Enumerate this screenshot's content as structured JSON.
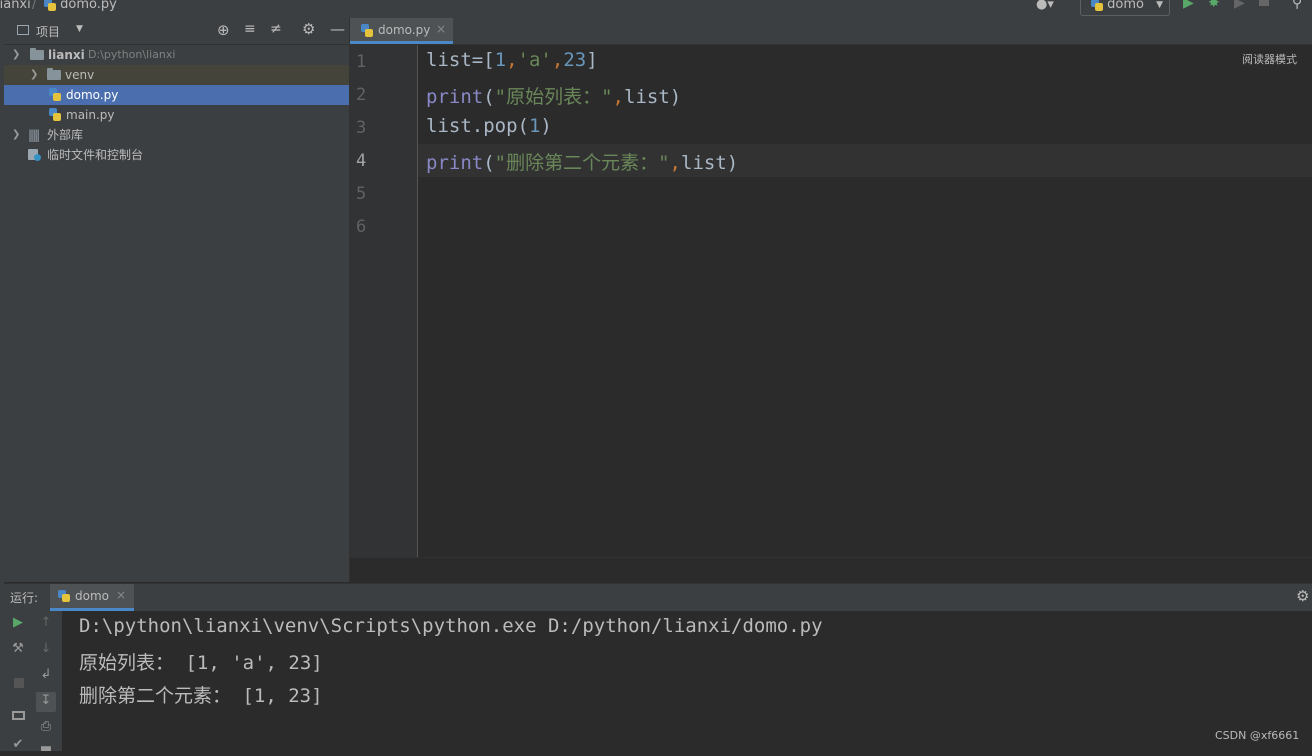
{
  "breadcrumb": {
    "project": "lianxi",
    "file": "domo.py"
  },
  "toolbar": {
    "run_config": "domo"
  },
  "project_panel": {
    "title": "项目",
    "tree": [
      {
        "label": "lianxi",
        "path": "D:\\python\\lianxi"
      },
      {
        "label": "venv"
      },
      {
        "label": "domo.py"
      },
      {
        "label": "main.py"
      },
      {
        "label": "外部库"
      },
      {
        "label": "临时文件和控制台"
      }
    ]
  },
  "editor": {
    "tab": "domo.py",
    "reader_mode": "阅读器模式",
    "line_numbers": [
      "1",
      "2",
      "3",
      "4",
      "5",
      "6"
    ],
    "lines": [
      {
        "p": [
          "list=[",
          "1",
          ",",
          "'a'",
          ",",
          "23",
          "]"
        ]
      },
      {
        "p": [
          "print",
          "(",
          "\"原始列表：\"",
          ",",
          "list)"
        ]
      },
      {
        "p": [
          "list.pop(",
          "1",
          ")"
        ]
      },
      {
        "p": [
          "print",
          "(",
          "\"删除第二个元素：\"",
          ",",
          "list)"
        ]
      }
    ]
  },
  "run_panel": {
    "label": "运行:",
    "tab": "domo",
    "output": [
      "D:\\python\\lianxi\\venv\\Scripts\\python.exe D:/python/lianxi/domo.py",
      "原始列表： [1, 'a', 23]",
      "删除第二个元素： [1, 23]"
    ]
  },
  "watermark": "CSDN @xf6661",
  "colors": {
    "keyword": "#8888c6",
    "number": "#6897bb",
    "string": "#6a8759",
    "comma": "#cc7832",
    "selection": "#4b6eaf"
  }
}
